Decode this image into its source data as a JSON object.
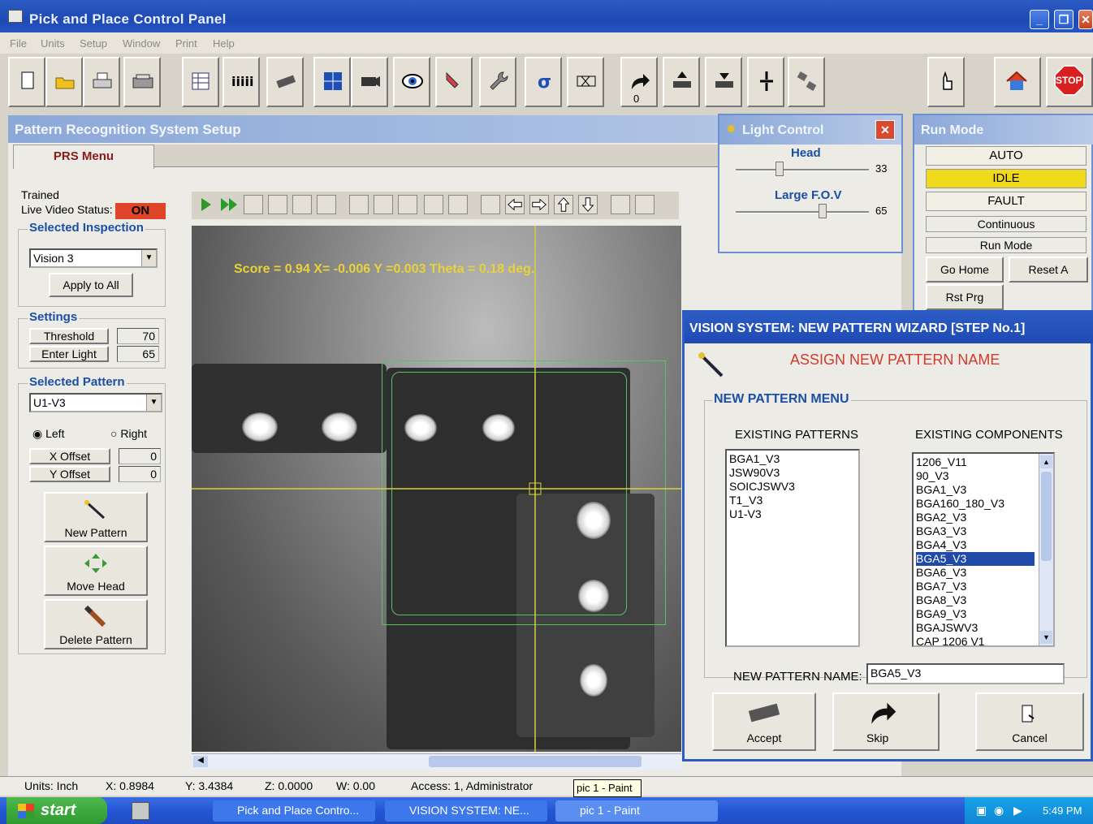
{
  "window": {
    "title": "Pick and Place Control Panel"
  },
  "menu": [
    "File",
    "Units",
    "Setup",
    "Window",
    "Print",
    "Help"
  ],
  "toolbar": {
    "icons": [
      "new-icon",
      "open-icon",
      "printer-icon",
      "scanner-icon",
      "spreadsheet-icon",
      "feeder-icon",
      "chip-icon",
      "fiducial-icon",
      "camera-icon",
      "eye-icon",
      "hand-icon",
      "wrench-icon",
      "sigma-icon",
      "measure-icon",
      "arrow-icon",
      "chip-up-icon",
      "chip-down-icon",
      "nozzle-icon",
      "swap-icon",
      "teach-icon",
      "home-icon",
      "stop-icon"
    ],
    "stop_label": "STOP",
    "counter_label": "0"
  },
  "prs": {
    "title": "Pattern Recognition System Setup",
    "tab": "PRS Menu",
    "trained": "Trained",
    "live_video_label": "Live Video Status:",
    "live_video_value": "ON",
    "selected_inspection_title": "Selected Inspection",
    "inspection_value": "Vision 3",
    "apply_all": "Apply to All",
    "settings_title": "Settings",
    "threshold_label": "Threshold",
    "threshold_value": "70",
    "enter_light_label": "Enter Light",
    "enter_light_value": "65",
    "selected_pattern_title": "Selected Pattern",
    "pattern_value": "U1-V3",
    "left_label": "Left",
    "right_label": "Right",
    "x_offset_label": "X Offset",
    "x_offset_value": "0",
    "y_offset_label": "Y Offset",
    "y_offset_value": "0",
    "new_pattern": "New Pattern",
    "move_head": "Move Head",
    "delete_pattern": "Delete Pattern"
  },
  "video": {
    "score_text": "Score = 0.94  X= -0.006  Y =0.003  Theta = 0.18 deg."
  },
  "light_control": {
    "title": "Light Control",
    "head_label": "Head",
    "head_value": "33",
    "fov_label": "Large F.O.V",
    "fov_value": "65",
    "head_level_pct": 33,
    "fov_level_pct": 65
  },
  "run_mode": {
    "title": "Run Mode",
    "auto": "AUTO",
    "idle": "IDLE",
    "fault": "FAULT",
    "continuous": "Continuous",
    "run_mode_btn": "Run Mode",
    "go_home": "Go Home",
    "reset_a": "Reset A",
    "rst_prg": "Rst Prg",
    "idle_color": "#f0d81a"
  },
  "wizard": {
    "title": "VISION SYSTEM: NEW PATTERN WIZARD [STEP No.1]",
    "heading": "ASSIGN NEW PATTERN NAME",
    "menu_title": "NEW PATTERN MENU",
    "existing_patterns_label": "EXISTING PATTERNS",
    "existing_components_label": "EXISTING COMPONENTS",
    "patterns": [
      "BGA1_V3",
      "JSW90V3",
      "SOICJSWV3",
      "T1_V3",
      "U1-V3"
    ],
    "components": [
      "1206_V11",
      "90_V3",
      "BGA1_V3",
      "BGA160_180_V3",
      "BGA2_V3",
      "BGA3_V3",
      "BGA4_V3",
      "BGA5_V3",
      "BGA6_V3",
      "BGA7_V3",
      "BGA8_V3",
      "BGA9_V3",
      "BGAJSWV3",
      "CAP 1206 V1"
    ],
    "selected_component": "BGA5_V3",
    "new_name_label": "NEW PATTERN NAME:",
    "new_name_value": "BGA5_V3",
    "accept": "Accept",
    "skip": "Skip",
    "cancel": "Cancel"
  },
  "status": {
    "units": "Units: Inch",
    "x": "X: 0.8984",
    "y": "Y: 3.4384",
    "z": "Z: 0.0000",
    "w": "W: 0.00",
    "access": "Access: 1, Administrator",
    "tooltip": "pic 1 - Paint"
  },
  "taskbar": {
    "start": "start",
    "tasks": [
      "Pick and Place Contro...",
      "VISION SYSTEM: NE...",
      "pic 1 - Paint"
    ],
    "clock": "5:49 PM"
  }
}
